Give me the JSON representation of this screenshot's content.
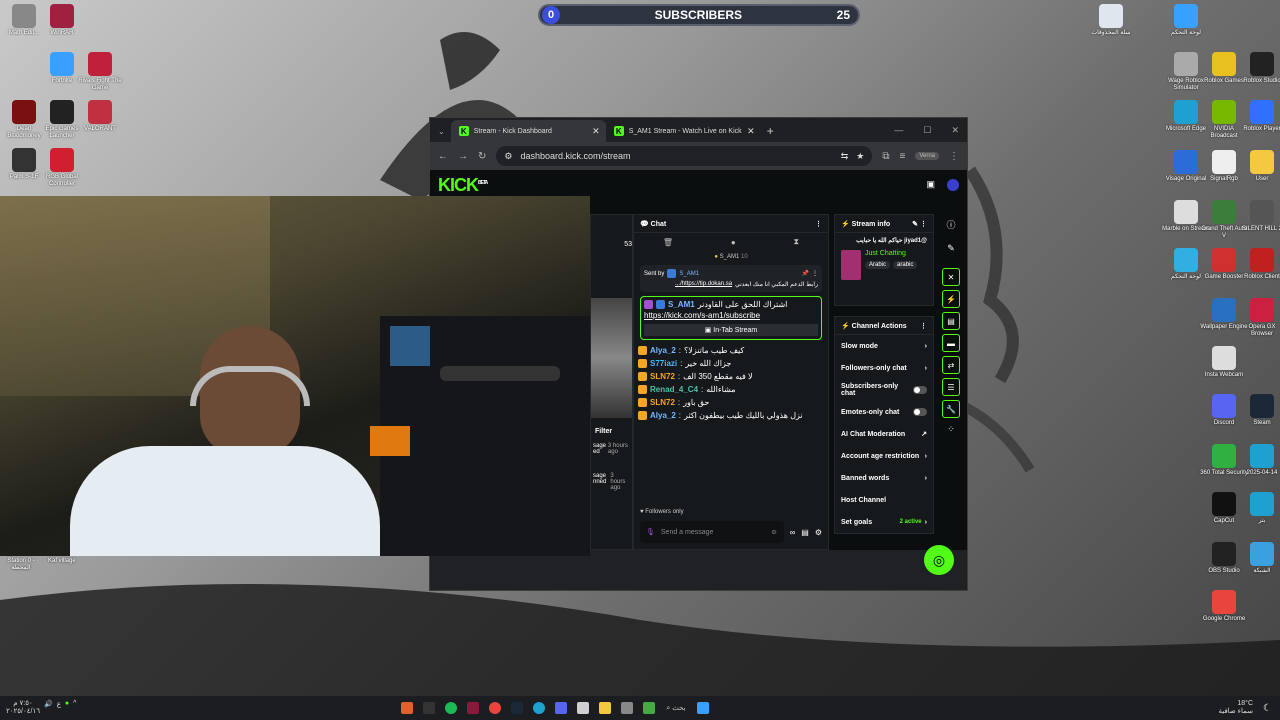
{
  "subscribers": {
    "label": "SUBSCRIBERS",
    "current": "0",
    "goal": "25"
  },
  "desktop_left": [
    {
      "label": "Math Edit...",
      "color": "#888"
    },
    {
      "label": "WinRAR",
      "color": "#a02040"
    },
    {
      "label": "Fortnite",
      "color": "#3aa0ff"
    },
    {
      "label": "Rivals Fight The Game",
      "color": "#c0203a"
    },
    {
      "label": "Dead Bloodmoney",
      "color": "#7a1010"
    },
    {
      "label": "Epic Games Launcher",
      "color": "#222"
    },
    {
      "label": "VALORANT",
      "color": "#c03040"
    },
    {
      "label": "Palm S-1F",
      "color": "#333"
    },
    {
      "label": "RGB Global Controller",
      "color": "#d02030"
    }
  ],
  "desktop_right": [
    {
      "label": "سلة المحذوفات",
      "color": "#dfe6ee"
    },
    {
      "label": "لوحة التحكم",
      "color": "#38a0ff"
    },
    {
      "label": "Wage Roblox Simulator",
      "color": "#aaa"
    },
    {
      "label": "Roblox Games",
      "color": "#e8c020"
    },
    {
      "label": "Roblox Studio",
      "color": "#222"
    },
    {
      "label": "Microsoft Edge",
      "color": "#1ea0d0"
    },
    {
      "label": "NVIDIA Broadcast",
      "color": "#76b900"
    },
    {
      "label": "Roblox Player",
      "color": "#3070ff"
    },
    {
      "label": "Visage Original",
      "color": "#2b6cd8"
    },
    {
      "label": "SignalRgb",
      "color": "#eee"
    },
    {
      "label": "User",
      "color": "#f5c842"
    },
    {
      "label": "Marble on Stream",
      "color": "#ddd"
    },
    {
      "label": "Grand Theft Auto V",
      "color": "#3b7d3b"
    },
    {
      "label": "SILENT HILL 2",
      "color": "#555"
    },
    {
      "label": "لوحة التحكم",
      "color": "#30b0e0"
    },
    {
      "label": "Game Booster",
      "color": "#d03030"
    },
    {
      "label": "Roblox Client",
      "color": "#c02020"
    },
    {
      "label": "Wallpaper Engine",
      "color": "#2a70c0"
    },
    {
      "label": "Opera GX Browser",
      "color": "#cc2040"
    },
    {
      "label": "Insta Webcam",
      "color": "#ddd"
    },
    {
      "label": "Discord",
      "color": "#5865f2"
    },
    {
      "label": "Steam",
      "color": "#1b2838"
    },
    {
      "label": "360 Total Security",
      "color": "#30b040"
    },
    {
      "label": "2025-04-14",
      "color": "#1ea0d0"
    },
    {
      "label": "CapCut",
      "color": "#111"
    },
    {
      "label": "بثر",
      "color": "#1ea0d0"
    },
    {
      "label": "OBS Studio",
      "color": "#222"
    },
    {
      "label": "الشبكة",
      "color": "#3aa0e0"
    },
    {
      "label": "Google Chrome",
      "color": "#e8453c"
    }
  ],
  "webcam_tray": [
    {
      "label": "Station 0 - المحطة"
    },
    {
      "label": "Kaf village"
    }
  ],
  "browser": {
    "tabs": [
      {
        "label": "Stream - Kick Dashboard",
        "active": true
      },
      {
        "label": "S_AM1 Stream - Watch Live on Kick",
        "active": false
      }
    ],
    "url": "dashboard.kick.com/stream",
    "profile": "Verna"
  },
  "kick": {
    "logo": "KICK",
    "logo_sup": "BETA",
    "partial_panel": {
      "stat": "53",
      "filter_label": "Filter",
      "rows": [
        {
          "text": "sage ed",
          "time": "3 hours ago"
        },
        {
          "text": "sage nned",
          "time": "3 hours ago"
        }
      ]
    },
    "chat": {
      "title": "Chat",
      "pinned_user": "S_AM1",
      "pinned_count": "10",
      "sent_by_label": "Sent by",
      "sent_by_user": "S_AM1",
      "sent_by_message": "رابط الدعم المكبي انا منك ابعدني",
      "sent_by_link": "https://tip.dokan.sa/...",
      "highlight_user": "S_AM1",
      "highlight_message": "اشتراك اللحق على القاودنر",
      "highlight_link": "https://kick.com/s-am1/subscribe",
      "in_tab_label": "In-Tab Stream",
      "messages": [
        {
          "user": "Alya_2",
          "color": "#79b8ff",
          "text": "كيف طيب ماتنزلا؟"
        },
        {
          "user": "S77iazi",
          "color": "#4ab7ff",
          "text": "جزاك الله خير"
        },
        {
          "user": "SLN72",
          "color": "#f5a623",
          "text": "لا فيه مقطع 350 الف"
        },
        {
          "user": "Renad_4_C4",
          "color": "#4ac2a8",
          "text": "مشاءالله"
        },
        {
          "user": "SLN72",
          "color": "#f5a623",
          "text": "حق باور"
        },
        {
          "user": "Alya_2",
          "color": "#79b8ff",
          "text": "نزل هذولي بالليك طيب بيطفون اكثر"
        }
      ],
      "followers_only": "Followers only",
      "input_placeholder": "Send a message"
    },
    "stream_info": {
      "title": "Stream info",
      "stream_title": "@jiyad1 حياكم الله يا حبايب",
      "category": "Just Chatting",
      "tags": [
        "Arabic",
        "arabic"
      ]
    },
    "channel_actions": {
      "title": "Channel Actions",
      "items": [
        {
          "label": "Slow mode",
          "control": "arrow"
        },
        {
          "label": "Followers-only chat",
          "control": "arrow"
        },
        {
          "label": "Subscribers-only chat",
          "control": "toggle"
        },
        {
          "label": "Emotes-only chat",
          "control": "toggle"
        },
        {
          "label": "AI Chat Moderation",
          "control": "external"
        },
        {
          "label": "Account age restriction",
          "control": "arrow"
        },
        {
          "label": "Banned words",
          "control": "arrow"
        },
        {
          "label": "Host Channel",
          "control": "none"
        },
        {
          "label": "Set goals",
          "control": "arrow",
          "extra": "2 active"
        }
      ]
    }
  },
  "taskbar": {
    "time": "٧:٥٠ م",
    "date": "٢٠٢٥/٠٤/١٦",
    "weather": "18°C",
    "weather_desc": "سماء صافية",
    "search_label": "بحث"
  },
  "colors": {
    "kick_green": "#53fc18",
    "chrome_dark": "#202124"
  }
}
